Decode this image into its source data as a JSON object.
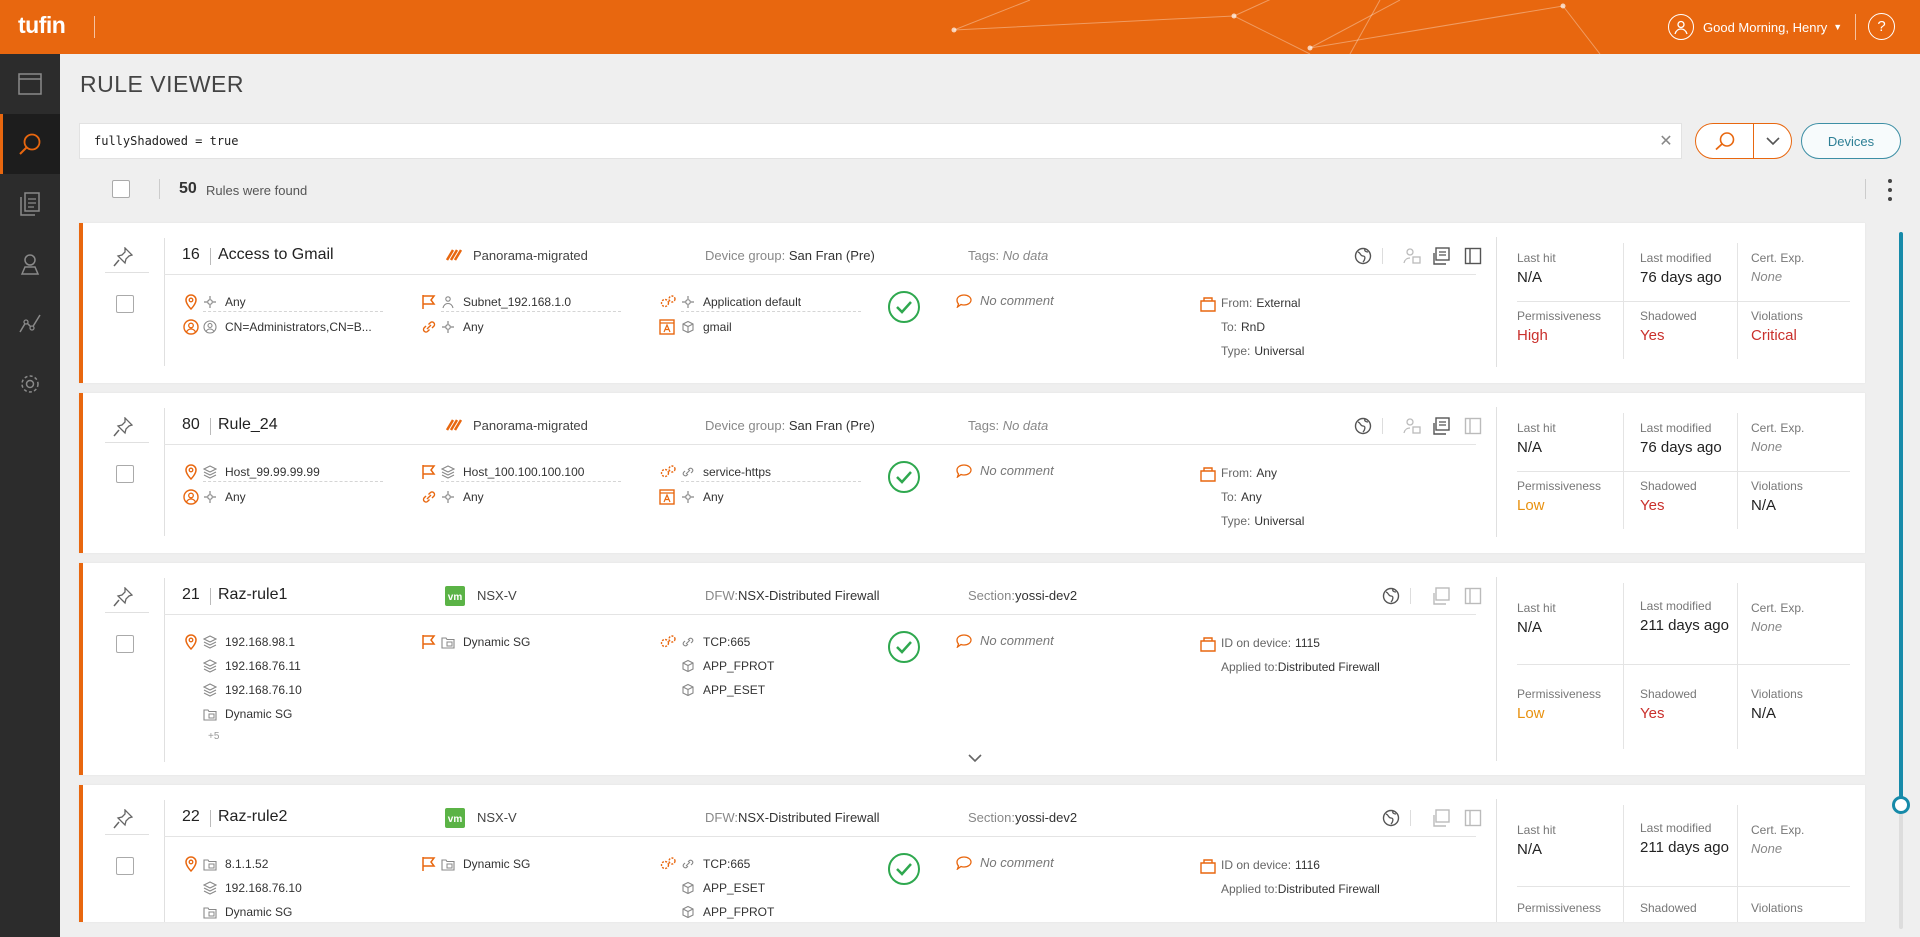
{
  "app": {
    "logo": "tufin",
    "greeting": "Good Morning, Henry",
    "help": "?"
  },
  "sidebar": {
    "items": [
      {
        "icon": "window-icon",
        "active": false
      },
      {
        "icon": "search-icon",
        "active": true
      },
      {
        "icon": "document-icon",
        "active": false
      },
      {
        "icon": "map-pin-icon",
        "active": false
      },
      {
        "icon": "path-icon",
        "active": false
      },
      {
        "icon": "gear-icon",
        "active": false
      }
    ]
  },
  "page": {
    "title": "RULE VIEWER"
  },
  "search": {
    "query": "fullyShadowed = true",
    "devices_label": "Devices"
  },
  "results": {
    "count": "50",
    "label": "Rules were found"
  },
  "colors": {
    "accent": "#e8670f",
    "teal": "#168aa9",
    "ok": "#2fa84f",
    "critical": "#c9302c",
    "low": "#e8910f"
  },
  "rules": [
    {
      "id": "16",
      "name": "Access to Gmail",
      "vendor": "Panorama-migrated",
      "vendor_icon": "palo-alto-icon",
      "group_label": "Device group:",
      "group_value": "San Fran (Pre)",
      "tags_label": "Tags:",
      "tags_value": "No data",
      "sources": [
        "Any"
      ],
      "users": [
        "CN=Administrators,CN=B..."
      ],
      "destinations": [
        "Subnet_192.168.1.0"
      ],
      "apps": [
        "Any"
      ],
      "services": [
        "Application default"
      ],
      "app_id": [
        "gmail"
      ],
      "comment": "No comment",
      "zone": {
        "from_label": "From:",
        "from": "External",
        "to_label": "To:",
        "to": "RnD",
        "type_label": "Type:",
        "type": "Universal"
      },
      "metrics": {
        "last_hit_label": "Last hit",
        "last_hit": "N/A",
        "last_modified_label": "Last modified",
        "last_modified": "76 days ago",
        "cert_label": "Cert. Exp.",
        "cert": "None",
        "perm_label": "Permissiveness",
        "perm": "High",
        "shadowed_label": "Shadowed",
        "shadowed": "Yes",
        "violations_label": "Violations",
        "violations": "Critical"
      }
    },
    {
      "id": "80",
      "name": "Rule_24",
      "vendor": "Panorama-migrated",
      "vendor_icon": "palo-alto-icon",
      "group_label": "Device group:",
      "group_value": "San Fran (Pre)",
      "tags_label": "Tags:",
      "tags_value": "No data",
      "sources": [
        "Host_99.99.99.99"
      ],
      "users": [
        "Any"
      ],
      "destinations": [
        "Host_100.100.100.100"
      ],
      "apps": [
        "Any"
      ],
      "services": [
        "service-https"
      ],
      "app_id": [
        "Any"
      ],
      "comment": "No comment",
      "zone": {
        "from_label": "From:",
        "from": "Any",
        "to_label": "To:",
        "to": "Any",
        "type_label": "Type:",
        "type": "Universal"
      },
      "metrics": {
        "last_hit_label": "Last hit",
        "last_hit": "N/A",
        "last_modified_label": "Last modified",
        "last_modified": "76 days ago",
        "cert_label": "Cert. Exp.",
        "cert": "None",
        "perm_label": "Permissiveness",
        "perm": "Low",
        "shadowed_label": "Shadowed",
        "shadowed": "Yes",
        "violations_label": "Violations",
        "violations": "N/A"
      }
    },
    {
      "id": "21",
      "name": "Raz-rule1",
      "vendor": "NSX-V",
      "vendor_icon": "vmware-icon",
      "group_label": "DFW:",
      "group_value": "NSX-Distributed Firewall",
      "tags_label": "Section:",
      "tags_value": "yossi-dev2",
      "sources": [
        "192.168.98.1",
        "192.168.76.11",
        "192.168.76.10",
        "Dynamic SG"
      ],
      "sources_more": "+5",
      "destinations": [
        "Dynamic SG"
      ],
      "services": [
        "TCP:665",
        "APP_FPROT",
        "APP_ESET"
      ],
      "comment": "No comment",
      "zone": {
        "id_label": "ID on device:",
        "id": "1115",
        "applied_label": "Applied to:",
        "applied": "Distributed Firewall"
      },
      "metrics": {
        "last_hit_label": "Last hit",
        "last_hit": "N/A",
        "last_modified_label": "Last modified",
        "last_modified": "211 days ago",
        "cert_label": "Cert. Exp.",
        "cert": "None",
        "perm_label": "Permissiveness",
        "perm": "Low",
        "shadowed_label": "Shadowed",
        "shadowed": "Yes",
        "violations_label": "Violations",
        "violations": "N/A"
      }
    },
    {
      "id": "22",
      "name": "Raz-rule2",
      "vendor": "NSX-V",
      "vendor_icon": "vmware-icon",
      "group_label": "DFW:",
      "group_value": "NSX-Distributed Firewall",
      "tags_label": "Section:",
      "tags_value": "yossi-dev2",
      "sources": [
        "8.1.1.52",
        "192.168.76.10",
        "Dynamic SG"
      ],
      "destinations": [
        "Dynamic SG"
      ],
      "services": [
        "TCP:665",
        "APP_ESET",
        "APP_FPROT"
      ],
      "comment": "No comment",
      "zone": {
        "id_label": "ID on device:",
        "id": "1116",
        "applied_label": "Applied to:",
        "applied": "Distributed Firewall"
      },
      "metrics": {
        "last_hit_label": "Last hit",
        "last_hit": "N/A",
        "last_modified_label": "Last modified",
        "last_modified": "211 days ago",
        "cert_label": "Cert. Exp.",
        "cert": "None",
        "perm_label": "Permissiveness",
        "shadowed_label": "Shadowed",
        "violations_label": "Violations"
      }
    }
  ]
}
